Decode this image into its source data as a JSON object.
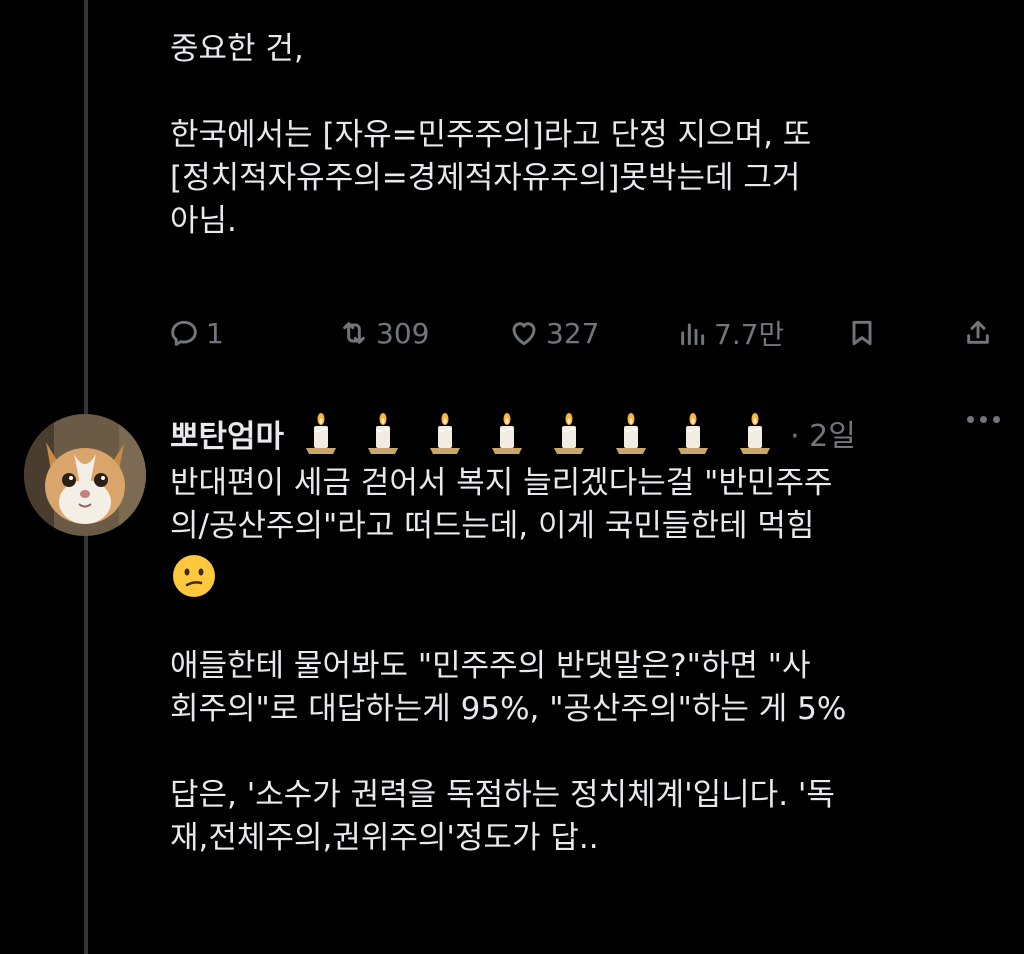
{
  "tweet1": {
    "line1": "중요한 건,",
    "para2_line1": "한국에서는 [자유=민주주의]라고 단정 지으며, 또",
    "para2_line2": "[정치적자유주의=경제적자유주의]못박는데 그거",
    "para2_line3": "아님.",
    "actions": {
      "reply_count": "1",
      "retweet_count": "309",
      "like_count": "327",
      "view_count": "7.7만"
    }
  },
  "tweet2": {
    "username": "뽀탄엄마",
    "name_emoji": [
      "candle-icon",
      "candle-icon",
      "candle-icon",
      "candle-icon",
      "candle-icon",
      "candle-icon",
      "candle-icon",
      "candle-icon"
    ],
    "timestamp": "· 2일",
    "p1_line1": "반대편이 세금 걷어서 복지 늘리겠다는걸 \"반민주주",
    "p1_line2": "의/공산주의\"라고 떠드는데, 이게 국민들한테 먹힘",
    "p1_emoji": "confused-face-icon",
    "p2_line1": "애들한테 물어봐도 \"민주주의 반댓말은?\"하면 \"사",
    "p2_line2": "회주의\"로 대답하는게 95%, \"공산주의\"하는 게 5%",
    "p3_line1": "답은, '소수가 권력을 독점하는 정치체계'입니다. '독",
    "p3_line2": "재,전체주의,권위주의'정도가 답.."
  },
  "colors": {
    "background": "#000000",
    "text": "#e7e9ea",
    "muted": "#71767b",
    "thread_line": "#333639"
  }
}
